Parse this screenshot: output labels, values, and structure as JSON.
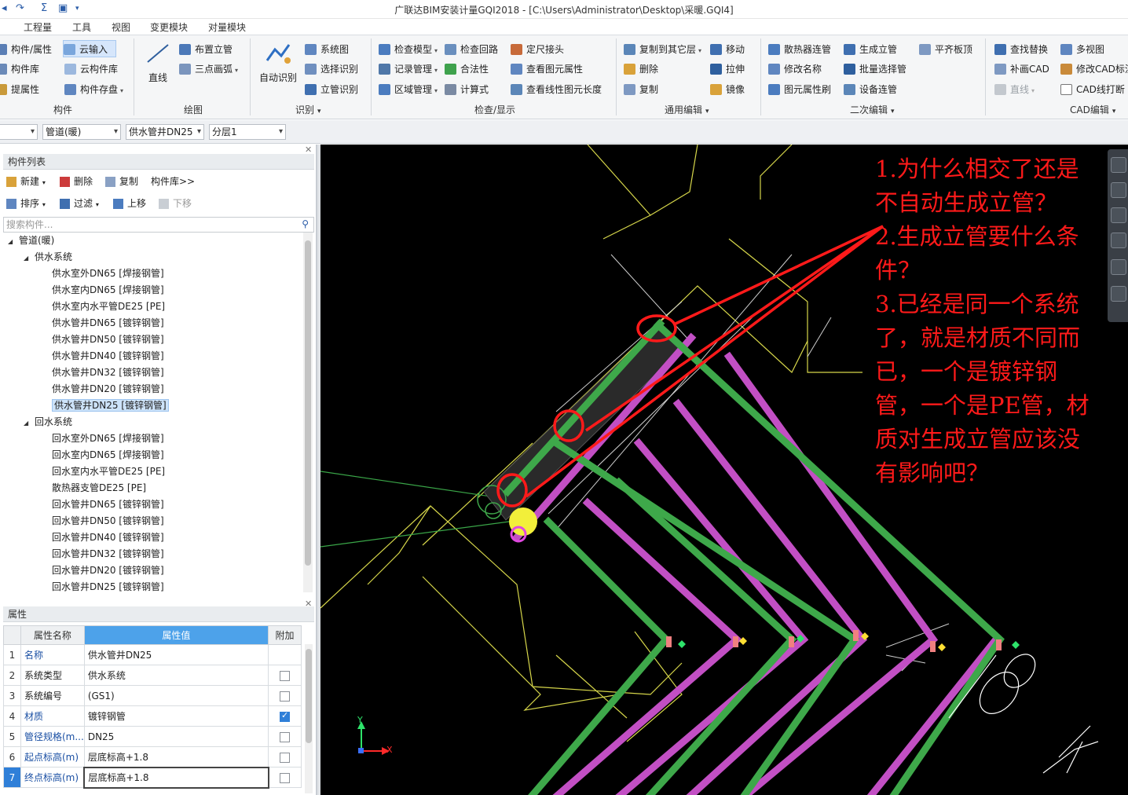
{
  "window": {
    "title": "广联达BIM安装计量GQI2018 - [C:\\Users\\Administrator\\Desktop\\采暖.GQI4]"
  },
  "menu": {
    "items": [
      "工程量",
      "工具",
      "视图",
      "变更模块",
      "对量模块"
    ]
  },
  "ribbon": {
    "component": {
      "label": "构件",
      "items": [
        "构件/属性",
        "云输入",
        "构件库",
        "云构件库",
        "提属性",
        "构件存盘"
      ]
    },
    "draw": {
      "label": "绘图",
      "line_label": "直线",
      "items": [
        "布置立管",
        "三点画弧"
      ]
    },
    "identify": {
      "label": "识别",
      "auto_label": "自动识别",
      "items": [
        "系统图",
        "选择识别",
        "立管识别"
      ]
    },
    "check": {
      "label": "检查/显示",
      "items": [
        "检查模型",
        "检查回路",
        "定尺接头",
        "记录管理",
        "合法性",
        "查看图元属性",
        "区域管理",
        "计算式",
        "查看线性图元长度"
      ]
    },
    "general": {
      "label": "通用编辑",
      "items": [
        "复制到其它层",
        "移动",
        "删除",
        "拉伸",
        "复制",
        "镜像"
      ]
    },
    "secondary": {
      "label": "二次编辑",
      "items": [
        "散热器连管",
        "生成立管",
        "平齐板顶",
        "修改名称",
        "批量选择管",
        "图元属性刷",
        "设备连管"
      ]
    },
    "cad": {
      "label": "CAD编辑",
      "items": [
        "查找替换",
        "多视图",
        "补画CAD",
        "修改CAD标注",
        "直线",
        "CAD线打断"
      ]
    }
  },
  "combos": [
    "",
    "管道(暖)",
    "供水管井DN25",
    "分层1"
  ],
  "component_list": {
    "title": "构件列表",
    "toolbar": [
      "新建",
      "删除",
      "复制",
      "构件库>>",
      "排序",
      "过滤",
      "上移",
      "下移"
    ],
    "search_placeholder": "搜索构件...",
    "root": "管道(暖)",
    "supply_group": "供水系统",
    "supply": [
      "供水室外DN65 [焊接钢管]",
      "供水室内DN65 [焊接钢管]",
      "供水室内水平管DE25 [PE]",
      "供水管井DN65 [镀锌钢管]",
      "供水管井DN50 [镀锌钢管]",
      "供水管井DN40 [镀锌钢管]",
      "供水管井DN32 [镀锌钢管]",
      "供水管井DN20 [镀锌钢管]",
      "供水管井DN25 [镀锌钢管]"
    ],
    "return_group": "回水系统",
    "return": [
      "回水室外DN65 [焊接钢管]",
      "回水室内DN65 [焊接钢管]",
      "回水室内水平管DE25 [PE]",
      "散热器支管DE25 [PE]",
      "回水管井DN65 [镀锌钢管]",
      "回水管井DN50 [镀锌钢管]",
      "回水管井DN40 [镀锌钢管]",
      "回水管井DN32 [镀锌钢管]",
      "回水管井DN20 [镀锌钢管]",
      "回水管井DN25 [镀锌钢管]"
    ]
  },
  "properties": {
    "title": "属性",
    "headers": [
      "属性名称",
      "属性值",
      "附加"
    ],
    "rows": [
      {
        "idx": "1",
        "name": "名称",
        "value": "供水管井DN25",
        "check": null
      },
      {
        "idx": "2",
        "name": "系统类型",
        "value": "供水系统",
        "check": false
      },
      {
        "idx": "3",
        "name": "系统编号",
        "value": "(GS1)",
        "check": false
      },
      {
        "idx": "4",
        "name": "材质",
        "value": "镀锌钢管",
        "check": true
      },
      {
        "idx": "5",
        "name": "管径规格(m...",
        "value": "DN25",
        "check": false
      },
      {
        "idx": "6",
        "name": "起点标高(m)",
        "value": "层底标高+1.8",
        "check": false
      },
      {
        "idx": "7",
        "name": "终点标高(m)",
        "value": "层底标高+1.8",
        "check": false
      }
    ]
  },
  "canvas": {
    "annotation_lines": [
      "1.为什么相交了还是",
      "不自动生成立管？",
      "2.生成立管要什么条",
      "件？",
      "3.已经是同一个系统",
      "了，就是材质不同而",
      "已，一个是镀锌钢",
      "管，一个是PE管，材",
      "质对生成立管应该没",
      "有影响吧？"
    ],
    "axis_y": "Y",
    "axis_x": "X",
    "colors": {
      "supply_pipe": "#3ea84a",
      "return_pipe": "#c24fc4",
      "annotation": "#ff1a1a",
      "outline": "#d6d64a"
    }
  }
}
